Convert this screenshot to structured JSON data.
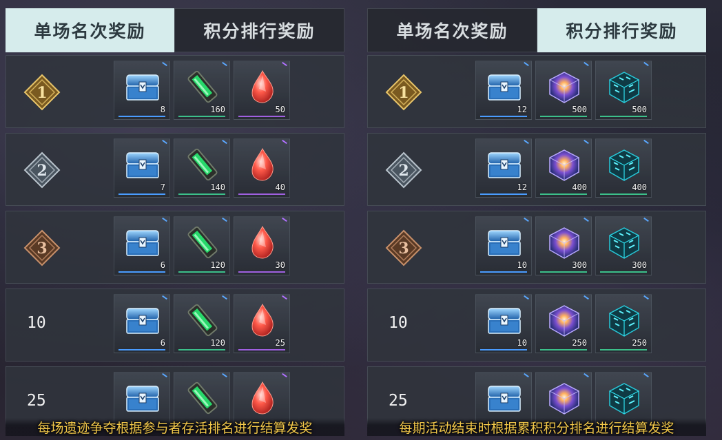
{
  "colors": {
    "tab_active_bg": "#d6ecec",
    "footer_text": "#f2c84a",
    "blue_bar": "#4a9cff",
    "green_bar": "#3cc08a",
    "purple_bar": "#a060e0"
  },
  "left": {
    "tabs": [
      {
        "label": "单场名次奖励",
        "active": true
      },
      {
        "label": "积分排行奖励",
        "active": false
      }
    ],
    "rows": [
      {
        "rank": "1",
        "rank_style": "gold",
        "rewards": [
          {
            "icon": "blue-chest-icon",
            "qty": "8",
            "rarity": "blue"
          },
          {
            "icon": "green-crystal-shard-icon",
            "qty": "160",
            "rarity": "green"
          },
          {
            "icon": "red-gem-icon",
            "qty": "50",
            "rarity": "purple"
          }
        ]
      },
      {
        "rank": "2",
        "rank_style": "silver",
        "rewards": [
          {
            "icon": "blue-chest-icon",
            "qty": "7",
            "rarity": "blue"
          },
          {
            "icon": "green-crystal-shard-icon",
            "qty": "140",
            "rarity": "green"
          },
          {
            "icon": "red-gem-icon",
            "qty": "40",
            "rarity": "purple"
          }
        ]
      },
      {
        "rank": "3",
        "rank_style": "bronze",
        "rewards": [
          {
            "icon": "blue-chest-icon",
            "qty": "6",
            "rarity": "blue"
          },
          {
            "icon": "green-crystal-shard-icon",
            "qty": "120",
            "rarity": "green"
          },
          {
            "icon": "red-gem-icon",
            "qty": "30",
            "rarity": "purple"
          }
        ]
      },
      {
        "rank": "10",
        "rank_style": "plain",
        "rewards": [
          {
            "icon": "blue-chest-icon",
            "qty": "6",
            "rarity": "blue"
          },
          {
            "icon": "green-crystal-shard-icon",
            "qty": "120",
            "rarity": "green"
          },
          {
            "icon": "red-gem-icon",
            "qty": "25",
            "rarity": "purple"
          }
        ]
      },
      {
        "rank": "25",
        "rank_style": "plain",
        "rewards": [
          {
            "icon": "blue-chest-icon",
            "qty": "",
            "rarity": "blue"
          },
          {
            "icon": "green-crystal-shard-icon",
            "qty": "",
            "rarity": "green"
          },
          {
            "icon": "red-gem-icon",
            "qty": "",
            "rarity": "purple"
          }
        ]
      }
    ],
    "footer": "每场遗迹争夺根据参与者存活排名进行结算发奖"
  },
  "right": {
    "tabs": [
      {
        "label": "单场名次奖励",
        "active": false
      },
      {
        "label": "积分排行奖励",
        "active": true
      }
    ],
    "rows": [
      {
        "rank": "1",
        "rank_style": "gold",
        "rewards": [
          {
            "icon": "blue-chest-icon",
            "qty": "12",
            "rarity": "blue"
          },
          {
            "icon": "glowing-cube-icon",
            "qty": "500",
            "rarity": "green"
          },
          {
            "icon": "cyan-circuit-cube-icon",
            "qty": "500",
            "rarity": "green"
          }
        ]
      },
      {
        "rank": "2",
        "rank_style": "silver",
        "rewards": [
          {
            "icon": "blue-chest-icon",
            "qty": "12",
            "rarity": "blue"
          },
          {
            "icon": "glowing-cube-icon",
            "qty": "400",
            "rarity": "green"
          },
          {
            "icon": "cyan-circuit-cube-icon",
            "qty": "400",
            "rarity": "green"
          }
        ]
      },
      {
        "rank": "3",
        "rank_style": "bronze",
        "rewards": [
          {
            "icon": "blue-chest-icon",
            "qty": "10",
            "rarity": "blue"
          },
          {
            "icon": "glowing-cube-icon",
            "qty": "300",
            "rarity": "green"
          },
          {
            "icon": "cyan-circuit-cube-icon",
            "qty": "300",
            "rarity": "green"
          }
        ]
      },
      {
        "rank": "10",
        "rank_style": "plain",
        "rewards": [
          {
            "icon": "blue-chest-icon",
            "qty": "10",
            "rarity": "blue"
          },
          {
            "icon": "glowing-cube-icon",
            "qty": "250",
            "rarity": "green"
          },
          {
            "icon": "cyan-circuit-cube-icon",
            "qty": "250",
            "rarity": "green"
          }
        ]
      },
      {
        "rank": "25",
        "rank_style": "plain",
        "rewards": [
          {
            "icon": "blue-chest-icon",
            "qty": "",
            "rarity": "blue"
          },
          {
            "icon": "glowing-cube-icon",
            "qty": "",
            "rarity": "green"
          },
          {
            "icon": "cyan-circuit-cube-icon",
            "qty": "",
            "rarity": "green"
          }
        ]
      }
    ],
    "footer": "每期活动结束时根据累积积分排名进行结算发奖"
  }
}
